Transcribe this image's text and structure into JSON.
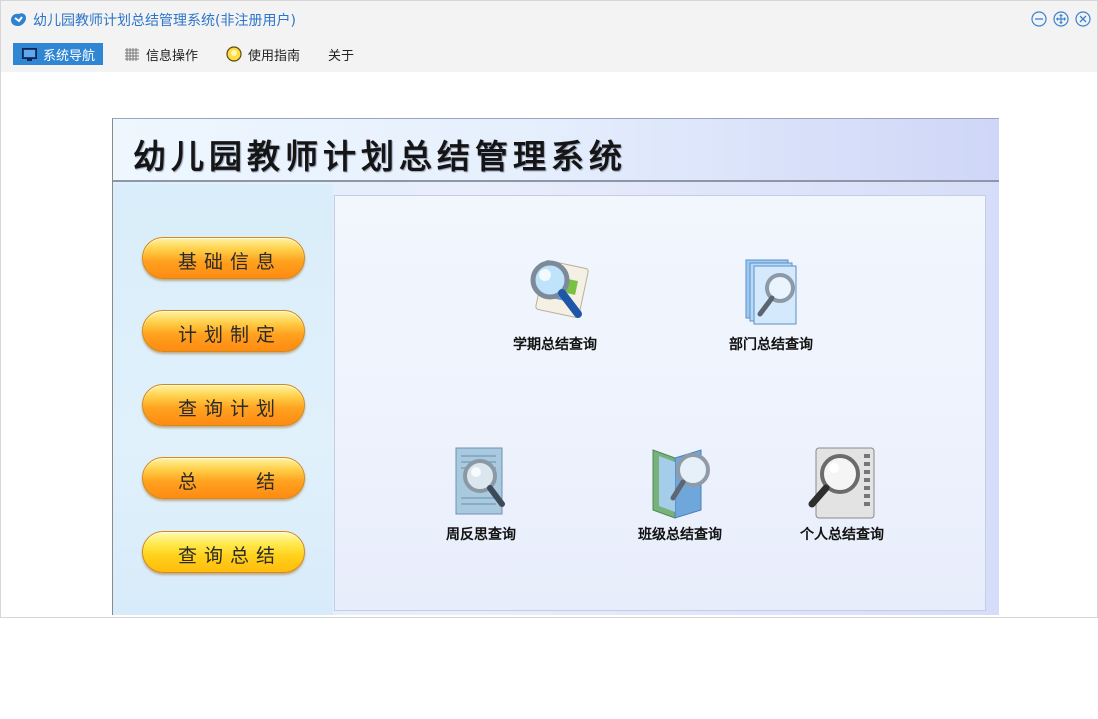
{
  "window": {
    "title": "幼儿园教师计划总结管理系统(非注册用户)",
    "accent": "#2f86d3"
  },
  "menu": {
    "items": [
      {
        "label": "系统导航",
        "icon": "monitor-icon",
        "active": true
      },
      {
        "label": "信息操作",
        "icon": "grid-icon",
        "active": false
      },
      {
        "label": "使用指南",
        "icon": "lightbulb-icon",
        "active": false
      },
      {
        "label": "关于",
        "icon": "",
        "active": false
      }
    ]
  },
  "banner": {
    "title": "幼儿园教师计划总结管理系统"
  },
  "sidebar": {
    "buttons": [
      {
        "label": "基础信息"
      },
      {
        "label": "计划制定"
      },
      {
        "label": "查询计划"
      },
      {
        "label": "总    结"
      },
      {
        "label": "查询总结"
      }
    ]
  },
  "queries": {
    "items": [
      {
        "label": "学期总结查询",
        "icon": "semester-search-icon"
      },
      {
        "label": "部门总结查询",
        "icon": "department-search-icon"
      },
      {
        "label": "周反思查询",
        "icon": "weekly-search-icon"
      },
      {
        "label": "班级总结查询",
        "icon": "class-search-icon"
      },
      {
        "label": "个人总结查询",
        "icon": "personal-search-icon"
      }
    ]
  }
}
